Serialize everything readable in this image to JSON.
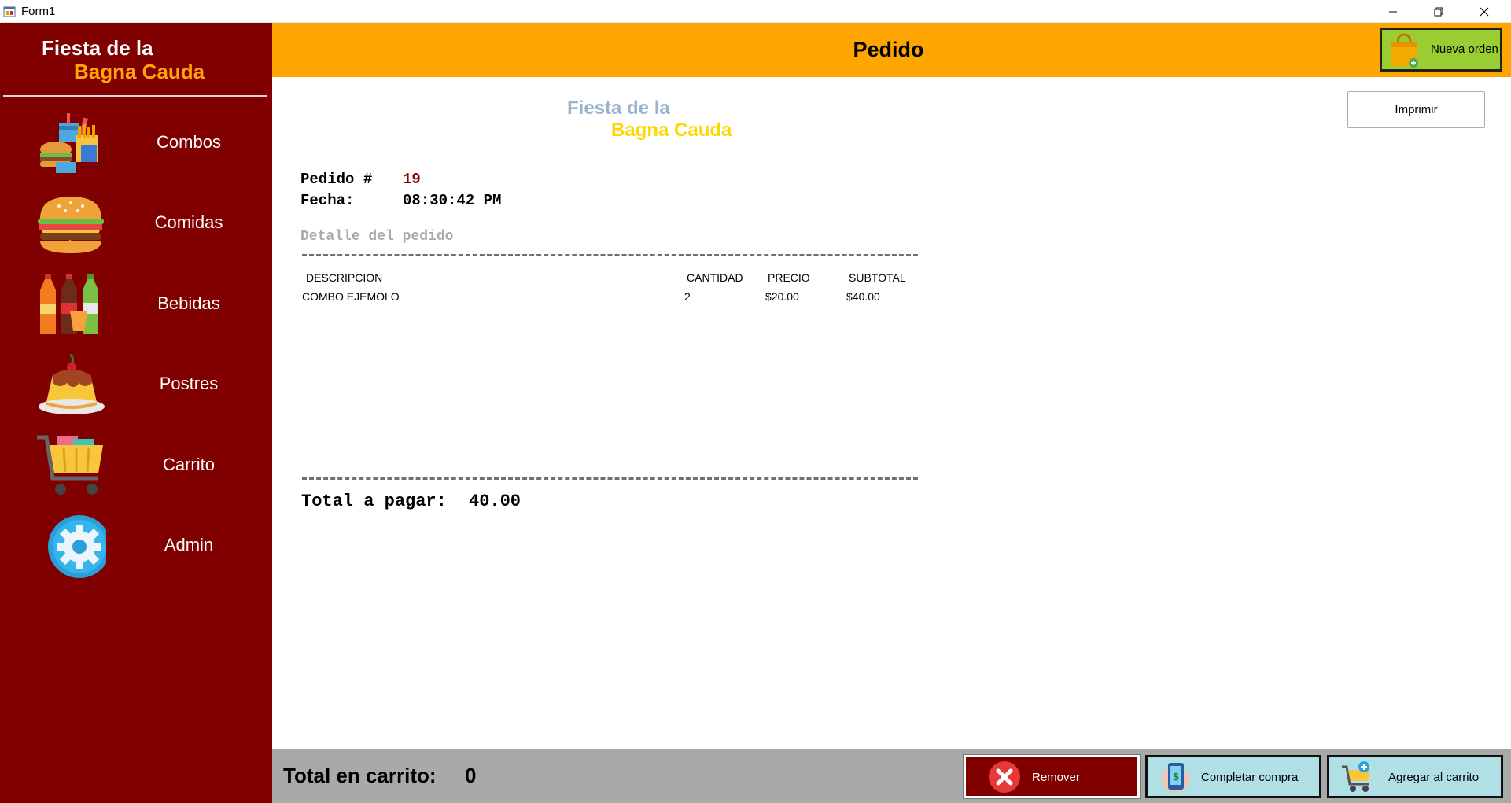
{
  "window": {
    "title": "Form1",
    "controls": [
      "minimize-icon",
      "restore-icon",
      "close-icon"
    ]
  },
  "sidebar": {
    "brand_line1": "Fiesta de la",
    "brand_line2": "Bagna Cauda",
    "items": [
      {
        "label": "Combos",
        "icon": "combo-meal-icon"
      },
      {
        "label": "Comidas",
        "icon": "burger-icon"
      },
      {
        "label": "Bebidas",
        "icon": "soda-bottles-icon"
      },
      {
        "label": "Postres",
        "icon": "flan-dessert-icon"
      },
      {
        "label": "Carrito",
        "icon": "shopping-cart-icon"
      },
      {
        "label": "Admin",
        "icon": "gear-icon"
      }
    ]
  },
  "header": {
    "title": "Pedido",
    "new_order_label": "Nueva orden"
  },
  "receipt": {
    "brand_line1": "Fiesta de la",
    "brand_line2": "Bagna Cauda",
    "print_label": "Imprimir",
    "order_label": "Pedido #",
    "order_number": "19",
    "date_label": "Fecha:",
    "date_value": "08:30:42 PM",
    "detail_title": "Detalle del pedido",
    "columns": [
      "DESCRIPCION",
      "CANTIDAD",
      "PRECIO",
      "SUBTOTAL"
    ],
    "rows": [
      [
        "COMBO EJEMOLO",
        "2",
        "$20.00",
        "$40.00"
      ]
    ],
    "total_label": "Total a pagar:",
    "total_value": "40.00"
  },
  "footer": {
    "cart_total_label": "Total en carrito:",
    "cart_total_value": "0",
    "remove_label": "Remover",
    "complete_label": "Completar compra",
    "add_label": "Agregar al carrito"
  },
  "colors": {
    "sidebar_bg": "#800000",
    "header_bg": "#ffa500",
    "brand_accent": "#ffa50a",
    "new_order_bg": "#9acd32",
    "footer_bg": "#a9a9a9",
    "action_button_bg": "#b0e0e6",
    "order_number_color": "#8b0000"
  }
}
